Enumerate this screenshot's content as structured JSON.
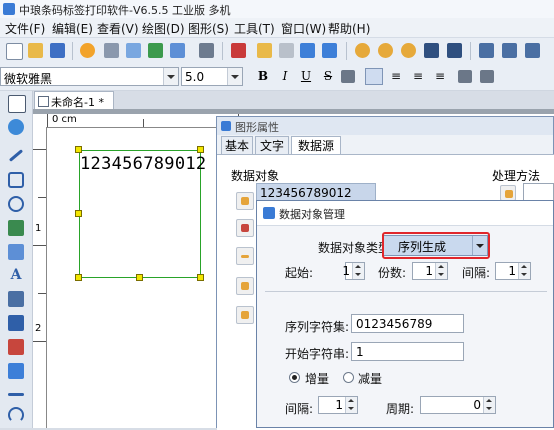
{
  "window": {
    "title": "中琅条码标签打印软件-V6.5.5 工业版 多机"
  },
  "menu": [
    "文件(F)",
    "编辑(E)",
    "查看(V)",
    "绘图(D)",
    "图形(S)",
    "工具(T)",
    "窗口(W)",
    "帮助(H)"
  ],
  "format_bar": {
    "font_name": "微软雅黑",
    "font_size": "5.0",
    "bold": "B",
    "italic": "I",
    "underline": "U",
    "strike": "S"
  },
  "document": {
    "tab_label": "未命名-1 *",
    "ruler_unit": "0 cm",
    "ruler_left_1": "1",
    "ruler_left_2": "2",
    "barcode_text": "123456789012"
  },
  "properties": {
    "title": "图形属性",
    "tabs": [
      "基本",
      "文字",
      "数据源"
    ],
    "data_objects_label": "数据对象",
    "data_object_value": "123456789012",
    "processing_label": "处理方法"
  },
  "dialog": {
    "title": "数据对象管理",
    "type_label": "数据对象类型:",
    "type_value": "序列生成",
    "start_label": "起始:",
    "start_value": "1",
    "copies_label": "份数:",
    "copies_value": "1",
    "interval_label": "间隔:",
    "interval_value": "1",
    "charset_label": "序列字符集:",
    "charset_value": "0123456789",
    "startchar_label": "开始字符串:",
    "startchar_value": "1",
    "increase_label": "增量",
    "decrease_label": "减量",
    "step_label": "间隔:",
    "step_value": "1",
    "period_label": "周期:",
    "period_value": "0"
  }
}
